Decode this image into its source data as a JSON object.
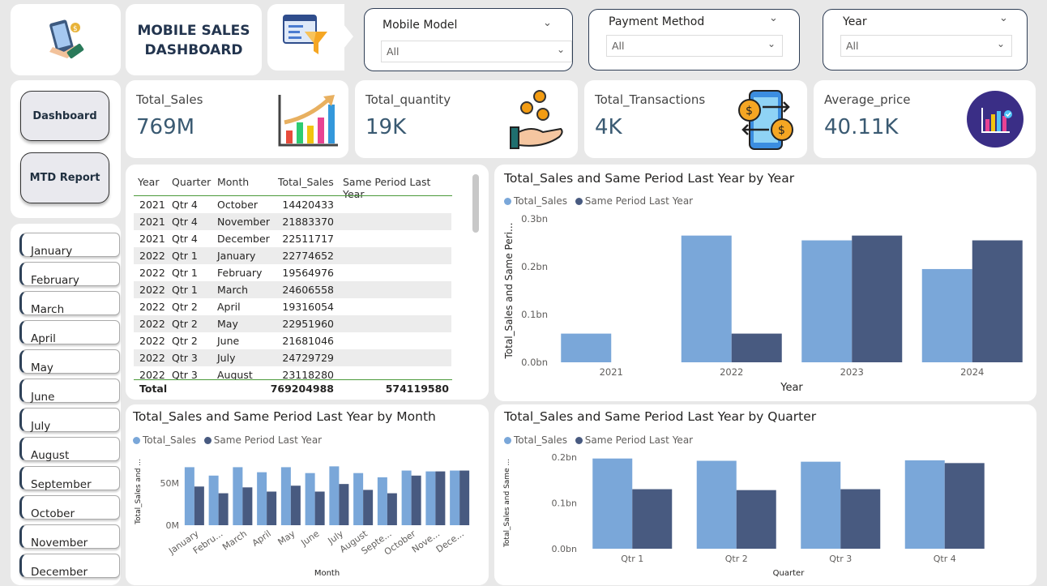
{
  "header": {
    "title_line1": "MOBILE SALES",
    "title_line2": "DASHBOARD"
  },
  "filters": [
    {
      "label": "Mobile Model",
      "value": "All"
    },
    {
      "label": "Payment Method",
      "value": "All"
    },
    {
      "label": "Year",
      "value": "All"
    }
  ],
  "kpis": [
    {
      "title": "Total_Sales",
      "value": "769M"
    },
    {
      "title": "Total_quantity",
      "value": "19K"
    },
    {
      "title": "Total_Transactions",
      "value": "4K"
    },
    {
      "title": "Average_price",
      "value": "40.11K"
    }
  ],
  "nav": {
    "dashboard": "Dashboard",
    "mtd": "MTD Report"
  },
  "months": [
    "January",
    "February",
    "March",
    "April",
    "May",
    "June",
    "July",
    "August",
    "September",
    "October",
    "November",
    "December"
  ],
  "table": {
    "headers": [
      "Year",
      "Quarter",
      "Month",
      "Total_Sales",
      "Same Period Last Year"
    ],
    "rows": [
      [
        "2021",
        "Qtr 4",
        "October",
        "14420433"
      ],
      [
        "2021",
        "Qtr 4",
        "November",
        "21883370"
      ],
      [
        "2021",
        "Qtr 4",
        "December",
        "22511717"
      ],
      [
        "2022",
        "Qtr 1",
        "January",
        "22774652"
      ],
      [
        "2022",
        "Qtr 1",
        "February",
        "19564976"
      ],
      [
        "2022",
        "Qtr 1",
        "March",
        "24606558"
      ],
      [
        "2022",
        "Qtr 2",
        "April",
        "19316054"
      ],
      [
        "2022",
        "Qtr 2",
        "May",
        "22951960"
      ],
      [
        "2022",
        "Qtr 2",
        "June",
        "21681046"
      ],
      [
        "2022",
        "Qtr 3",
        "July",
        "24729729"
      ],
      [
        "2022",
        "Qtr 3",
        "August",
        "23118280"
      ]
    ],
    "total_label": "Total",
    "total_sales": "769204988",
    "total_last_year": "574119580"
  },
  "colors": {
    "total_sales": "#7aa7d9",
    "last_year": "#485a80",
    "accent": "#2e4158"
  },
  "legend": {
    "s1": "Total_Sales",
    "s2": "Same Period Last Year"
  },
  "chart_data": [
    {
      "type": "bar",
      "title": "Total_Sales and Same Period Last Year by Year",
      "xlabel": "Year",
      "ylabel": "Total_Sales and Same Peri...",
      "categories": [
        "2021",
        "2022",
        "2023",
        "2024"
      ],
      "series": [
        {
          "name": "Total_Sales",
          "values": [
            0.06,
            0.265,
            0.255,
            0.195
          ]
        },
        {
          "name": "Same Period Last Year",
          "values": [
            0,
            0.06,
            0.265,
            0.255
          ]
        }
      ],
      "yticks": [
        "0.0bn",
        "0.1bn",
        "0.2bn",
        "0.3bn"
      ],
      "ylim": [
        0,
        0.3
      ],
      "legend": "top-left"
    },
    {
      "type": "bar",
      "title": "Total_Sales and Same Period Last Year by Month",
      "xlabel": "Month",
      "ylabel": "Total_Sales and ...",
      "categories": [
        "January",
        "Febru...",
        "March",
        "April",
        "May",
        "June",
        "July",
        "August",
        "Septe...",
        "October",
        "Nove...",
        "Dece..."
      ],
      "series": [
        {
          "name": "Total_Sales",
          "values": [
            69,
            59,
            69,
            63,
            69,
            62,
            70,
            62,
            57,
            65,
            64,
            65
          ]
        },
        {
          "name": "Same Period Last Year",
          "values": [
            46,
            38,
            45,
            40,
            47,
            40,
            49,
            42,
            38,
            59,
            64,
            65
          ]
        }
      ],
      "yticks": [
        "0M",
        "50M"
      ],
      "ylim": [
        0,
        80
      ],
      "legend": "top-left"
    },
    {
      "type": "bar",
      "title": "Total_Sales and Same Period Last Year by Quarter",
      "xlabel": "Quarter",
      "ylabel": "Total_Sales and Same ...",
      "categories": [
        "Qtr 1",
        "Qtr 2",
        "Qtr 3",
        "Qtr 4"
      ],
      "series": [
        {
          "name": "Total_Sales",
          "values": [
            0.197,
            0.192,
            0.19,
            0.193
          ]
        },
        {
          "name": "Same Period Last Year",
          "values": [
            0.13,
            0.128,
            0.13,
            0.187
          ]
        }
      ],
      "yticks": [
        "0.0bn",
        "0.1bn",
        "0.2bn"
      ],
      "ylim": [
        0,
        0.2
      ],
      "legend": "top-left"
    }
  ]
}
